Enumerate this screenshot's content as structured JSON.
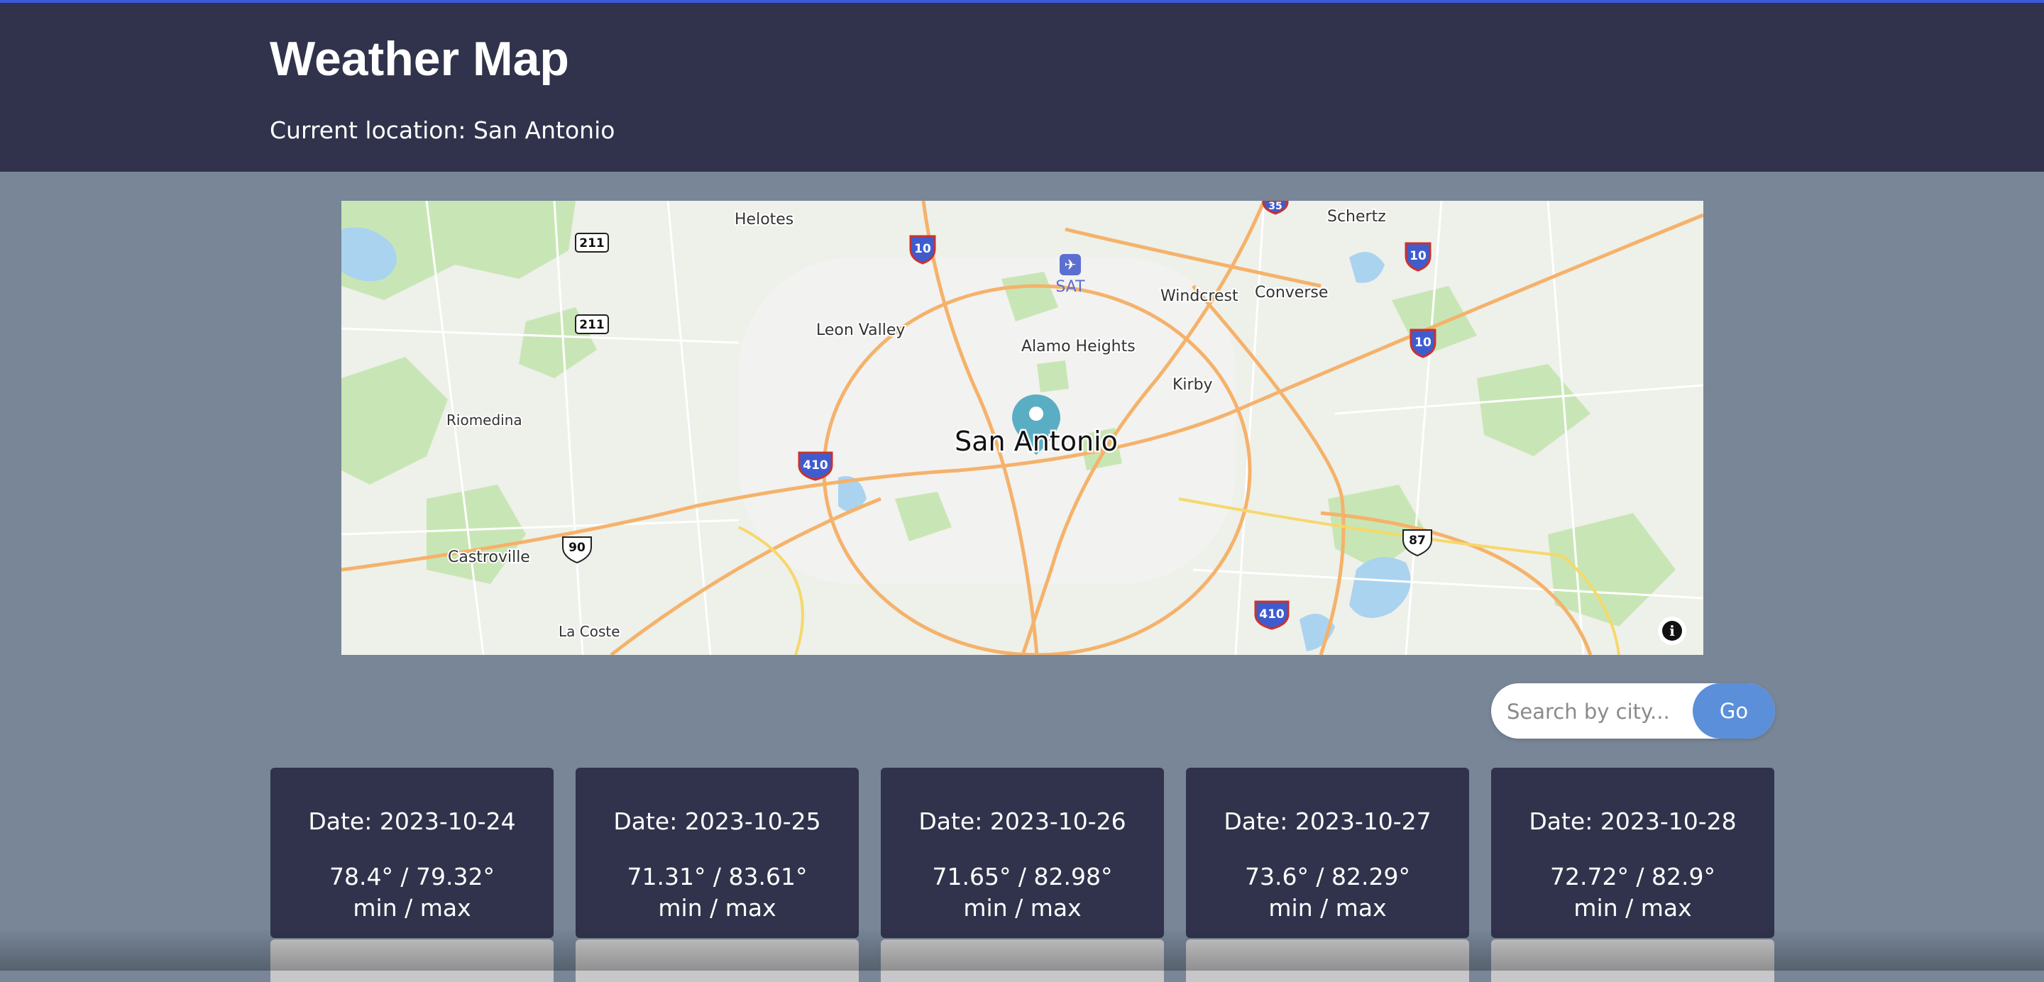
{
  "header": {
    "title": "Weather Map",
    "subtitle": "Current location: San Antonio"
  },
  "map": {
    "city_label": "San Antonio",
    "place_labels": [
      "Helotes",
      "Schertz",
      "Windcrest",
      "Converse",
      "Leon Valley",
      "Alamo Heights",
      "Kirby",
      "Riomedina",
      "Castroville",
      "La Coste",
      "SAT"
    ],
    "route_shields": [
      "211",
      "211",
      "10",
      "10",
      "10",
      "410",
      "410",
      "90",
      "87",
      "35"
    ],
    "info_glyph": "i",
    "marker_icon": "map-pin-icon",
    "colors": {
      "marker": "#5aaec4",
      "highway": "#f5b26b",
      "water": "#aad3f0",
      "park": "#c8e6b5"
    }
  },
  "search": {
    "placeholder": "Search by city...",
    "button_label": "Go"
  },
  "forecast": [
    {
      "date": "Date: 2023-10-24",
      "temps": "78.4° / 79.32°",
      "unit": "min / max"
    },
    {
      "date": "Date: 2023-10-25",
      "temps": "71.31° / 83.61°",
      "unit": "min / max"
    },
    {
      "date": "Date: 2023-10-26",
      "temps": "71.65° / 82.98°",
      "unit": "min / max"
    },
    {
      "date": "Date: 2023-10-27",
      "temps": "73.6° / 82.29°",
      "unit": "min / max"
    },
    {
      "date": "Date: 2023-10-28",
      "temps": "72.72° / 82.9°",
      "unit": "min / max"
    }
  ],
  "colors": {
    "header_bg": "#30334b",
    "page_bg": "#788698",
    "accent": "#5b8fd9",
    "card_bg": "#30334b"
  }
}
